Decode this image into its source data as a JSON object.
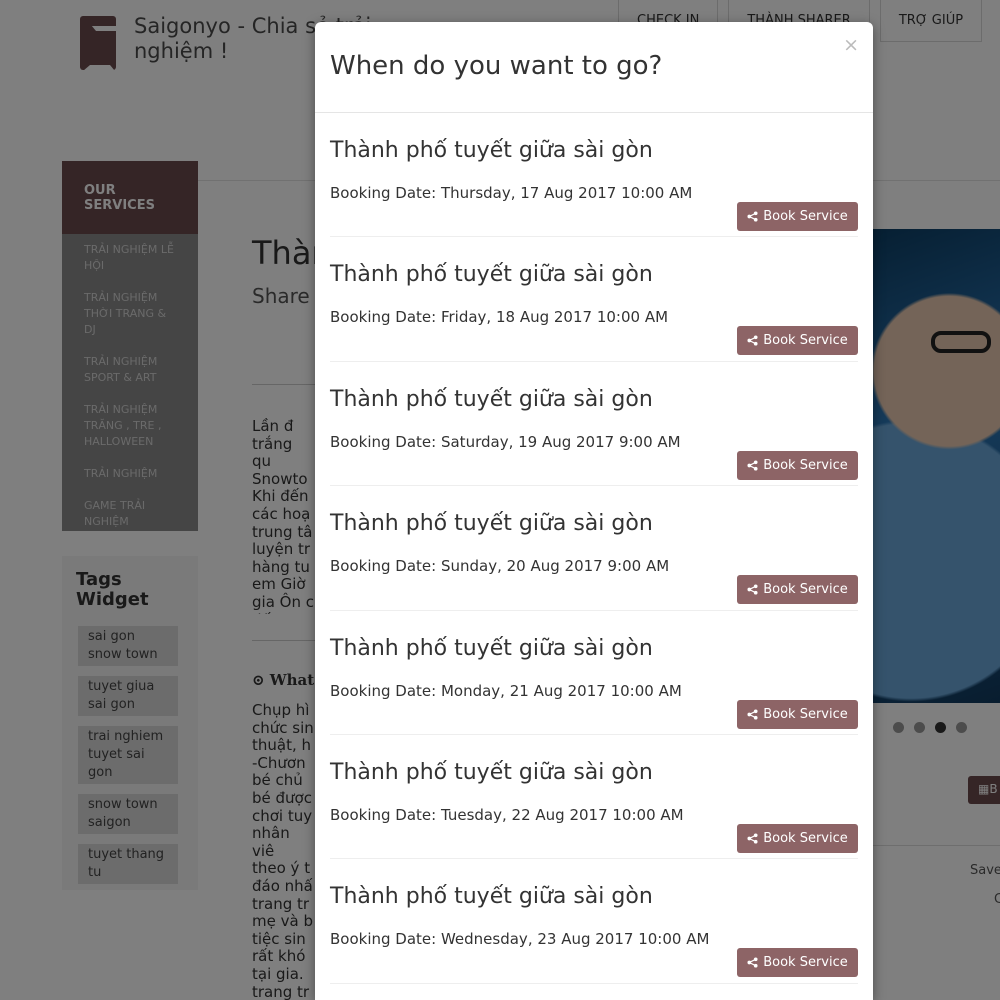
{
  "site": {
    "title": "Saigonyo - Chia sẻ trải nghiệm !",
    "nav": [
      "CHECK IN",
      "THÀNH SHARER",
      "TRỢ GIÚP"
    ]
  },
  "sidebar": {
    "heading": "OUR SERVICES",
    "items": [
      "TRẢI NGHIỆM LỄ HỘI",
      "TRẢI NGHIỆM THỜI TRANG & DJ",
      "TRẢI NGHIỆM SPORT & ART",
      "TRẢI NGHIỆM TRĂNG , TRE , HALLOWEEN",
      "TRẢI NGHIỆM",
      "GAME TRẢI NGHIỆM"
    ]
  },
  "tags_widget": {
    "title": "Tags Widget",
    "tags": [
      "sai gon snow town",
      "tuyet giua sai gon",
      "trai nghiem tuyet sai gon",
      "snow town saigon",
      "tuyet thang tu"
    ]
  },
  "main": {
    "title": "Thàn",
    "subtitle": "Share",
    "paragraph1": "Lần đ\ntrắng qu\nSnowto\nKhi đến\ncác hoạ\ntrung tâ\nluyện tr\nhàng tu\nem Giờ\ngia Ôn c\nđến Sno",
    "what_label": "What",
    "paragraph2": "Chụp hì\nchức sin\nthuật, h\n-Chươn\nbé chủ\nbé được\nchơi tuy\nnhân viê\ntheo ý t\nđáo nhấ\ntrang tr\nmẹ và b\ntiệc sin\nrất khó\ntại gia.\ntrang tr\nsinh nhậ"
  },
  "side": {
    "save_text": "Save",
    "small_text": "C",
    "button_label": "B"
  },
  "modal": {
    "title": "When do you want to go?",
    "close_label": "×",
    "services": [
      {
        "title": "Thành phố tuyết giữa sài gòn",
        "date": "Booking Date: Thursday, 17 Aug 2017 10:00 AM",
        "button": "Book Service"
      },
      {
        "title": "Thành phố tuyết giữa sài gòn",
        "date": "Booking Date: Friday, 18 Aug 2017 10:00 AM",
        "button": "Book Service"
      },
      {
        "title": "Thành phố tuyết giữa sài gòn",
        "date": "Booking Date: Saturday, 19 Aug 2017 9:00 AM",
        "button": "Book Service"
      },
      {
        "title": "Thành phố tuyết giữa sài gòn",
        "date": "Booking Date: Sunday, 20 Aug 2017 9:00 AM",
        "button": "Book Service"
      },
      {
        "title": "Thành phố tuyết giữa sài gòn",
        "date": "Booking Date: Monday, 21 Aug 2017 10:00 AM",
        "button": "Book Service"
      },
      {
        "title": "Thành phố tuyết giữa sài gòn",
        "date": "Booking Date: Tuesday, 22 Aug 2017 10:00 AM",
        "button": "Book Service"
      },
      {
        "title": "Thành phố tuyết giữa sài gòn",
        "date": "Booking Date: Wednesday, 23 Aug 2017 10:00 AM",
        "button": "Book Service"
      }
    ]
  },
  "colors": {
    "brand": "#6b4a4c",
    "button": "#8d6466",
    "backdrop": "rgba(0,0,0,0.5)"
  },
  "icons": [
    "logo-icon",
    "share-icon",
    "circle-dot-icon",
    "calendar-icon",
    "close-icon"
  ]
}
